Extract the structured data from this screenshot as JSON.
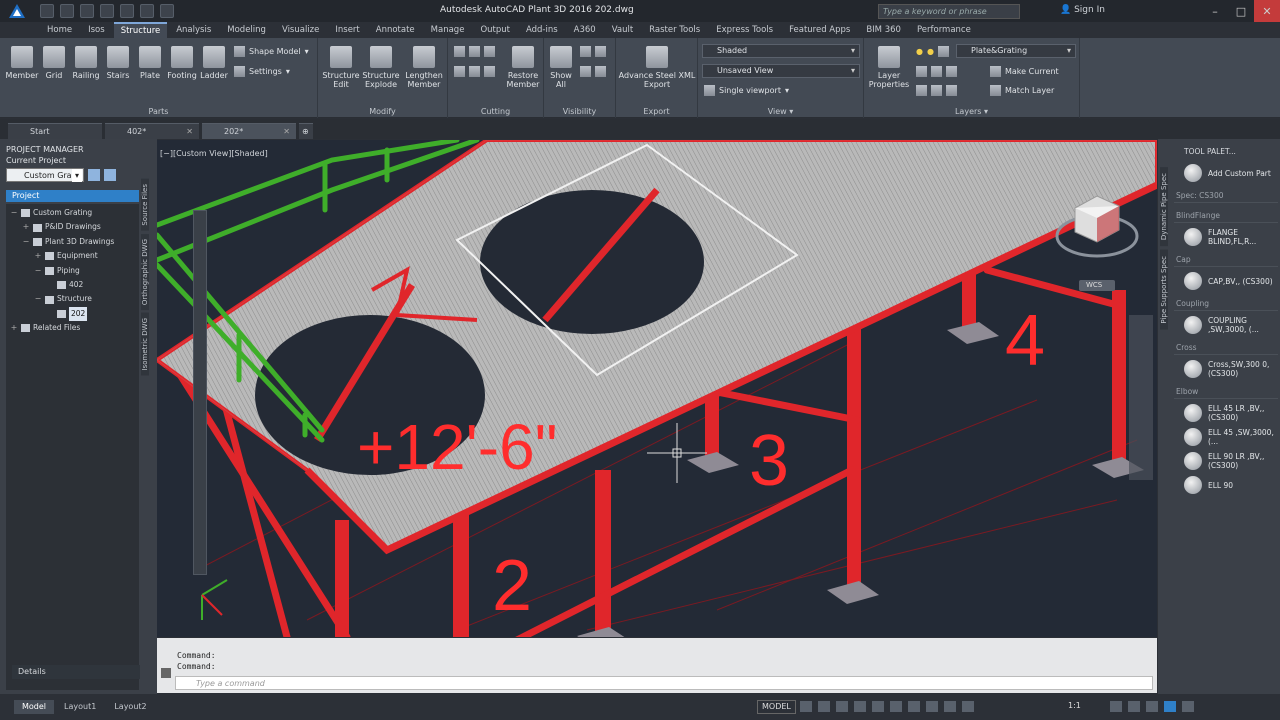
{
  "titlebar": {
    "title": "Autodesk AutoCAD Plant 3D 2016   202.dwg",
    "search_placeholder": "Type a keyword or phrase",
    "signin": "Sign In"
  },
  "tabs": [
    "Home",
    "Isos",
    "Structure",
    "Analysis",
    "Modeling",
    "Visualize",
    "Insert",
    "Annotate",
    "Manage",
    "Output",
    "Add-ins",
    "A360",
    "Vault",
    "Raster Tools",
    "Express Tools",
    "Featured Apps",
    "BIM 360",
    "Performance"
  ],
  "active_tab": "Structure",
  "ribbon": {
    "parts": {
      "title": "Parts",
      "buttons": [
        "Member",
        "Grid",
        "Railing",
        "Stairs",
        "Plate",
        "Footing",
        "Ladder"
      ],
      "shape_model": "Shape Model",
      "settings": "Settings"
    },
    "modify": {
      "title": "Modify",
      "structure_edit": "Structure Edit",
      "structure_explode": "Structure Explode",
      "lengthen_member": "Lengthen Member"
    },
    "cutting": {
      "title": "Cutting",
      "restore_member": "Restore Member"
    },
    "visibility": {
      "title": "Visibility",
      "show_all": "Show All"
    },
    "export": {
      "title": "Export",
      "advance_steel": "Advance Steel XML Export"
    },
    "view": {
      "title": "View",
      "visual_style": "Shaded",
      "named_view": "Unsaved View",
      "viewport": "Single viewport"
    },
    "layers": {
      "title": "Layers",
      "layer_properties": "Layer Properties",
      "current_layer": "Plate&Grating",
      "make_current": "Make Current",
      "match_layer": "Match Layer"
    }
  },
  "doc_tabs": [
    "Start",
    "402*",
    "202*"
  ],
  "project_manager": {
    "header": "PROJECT MANAGER",
    "current_project_label": "Current Project",
    "current_project": "Custom Gra",
    "project_tab": "Project",
    "tree": [
      {
        "label": "Custom Grating",
        "level": 0,
        "exp": "−"
      },
      {
        "label": "P&ID Drawings",
        "level": 1,
        "exp": "+"
      },
      {
        "label": "Plant 3D Drawings",
        "level": 1,
        "exp": "−"
      },
      {
        "label": "Equipment",
        "level": 2,
        "exp": "+"
      },
      {
        "label": "Piping",
        "level": 2,
        "exp": "−"
      },
      {
        "label": "402",
        "level": 3,
        "exp": ""
      },
      {
        "label": "Structure",
        "level": 2,
        "exp": "−"
      },
      {
        "label": "202",
        "level": 3,
        "exp": "",
        "selected": true
      },
      {
        "label": "Related Files",
        "level": 0,
        "exp": "+"
      }
    ],
    "side_tabs": [
      "Source Files",
      "Orthographic DWG",
      "Isometric DWG"
    ],
    "details": "Details"
  },
  "viewport": {
    "label": "[−][Custom View][Shaded]",
    "elevation": "+12'-6\"",
    "grid_numbers": [
      "2",
      "3",
      "4"
    ],
    "wcs": "WCS"
  },
  "command": {
    "history": [
      "Command:",
      "Command:"
    ],
    "placeholder": "Type a command"
  },
  "palette": {
    "title": "TOOL PALET...",
    "side_tabs": [
      "Dynamic Pipe Spec",
      "Pipe Supports Spec"
    ],
    "items": [
      {
        "type": "item",
        "label": "Add Custom Part"
      },
      {
        "type": "cat",
        "label": "Spec: CS300"
      },
      {
        "type": "cat",
        "label": "BlindFlange"
      },
      {
        "type": "item",
        "label": "FLANGE BLIND,FL,R..."
      },
      {
        "type": "cat",
        "label": "Cap"
      },
      {
        "type": "item",
        "label": "CAP,BV,, (CS300)"
      },
      {
        "type": "cat",
        "label": "Coupling"
      },
      {
        "type": "item",
        "label": "COUPLING ,SW,3000, (..."
      },
      {
        "type": "cat",
        "label": "Cross"
      },
      {
        "type": "item",
        "label": "Cross,SW,300 0, (CS300)"
      },
      {
        "type": "cat",
        "label": "Elbow"
      },
      {
        "type": "item",
        "label": "ELL 45 LR ,BV,, (CS300)"
      },
      {
        "type": "item",
        "label": "ELL 45 ,SW,3000, (..."
      },
      {
        "type": "item",
        "label": "ELL 90 LR ,BV,, (CS300)"
      },
      {
        "type": "item",
        "label": "ELL 90"
      }
    ]
  },
  "status": {
    "layouts": [
      "Model",
      "Layout1",
      "Layout2"
    ],
    "model": "MODEL",
    "scale": "1:1"
  },
  "colors": {
    "steel": "#e0262b",
    "grating": "#bdbdbd",
    "railing": "#3fae2a",
    "viewport_bg": "#232a36",
    "accent": "#2f80c8"
  }
}
